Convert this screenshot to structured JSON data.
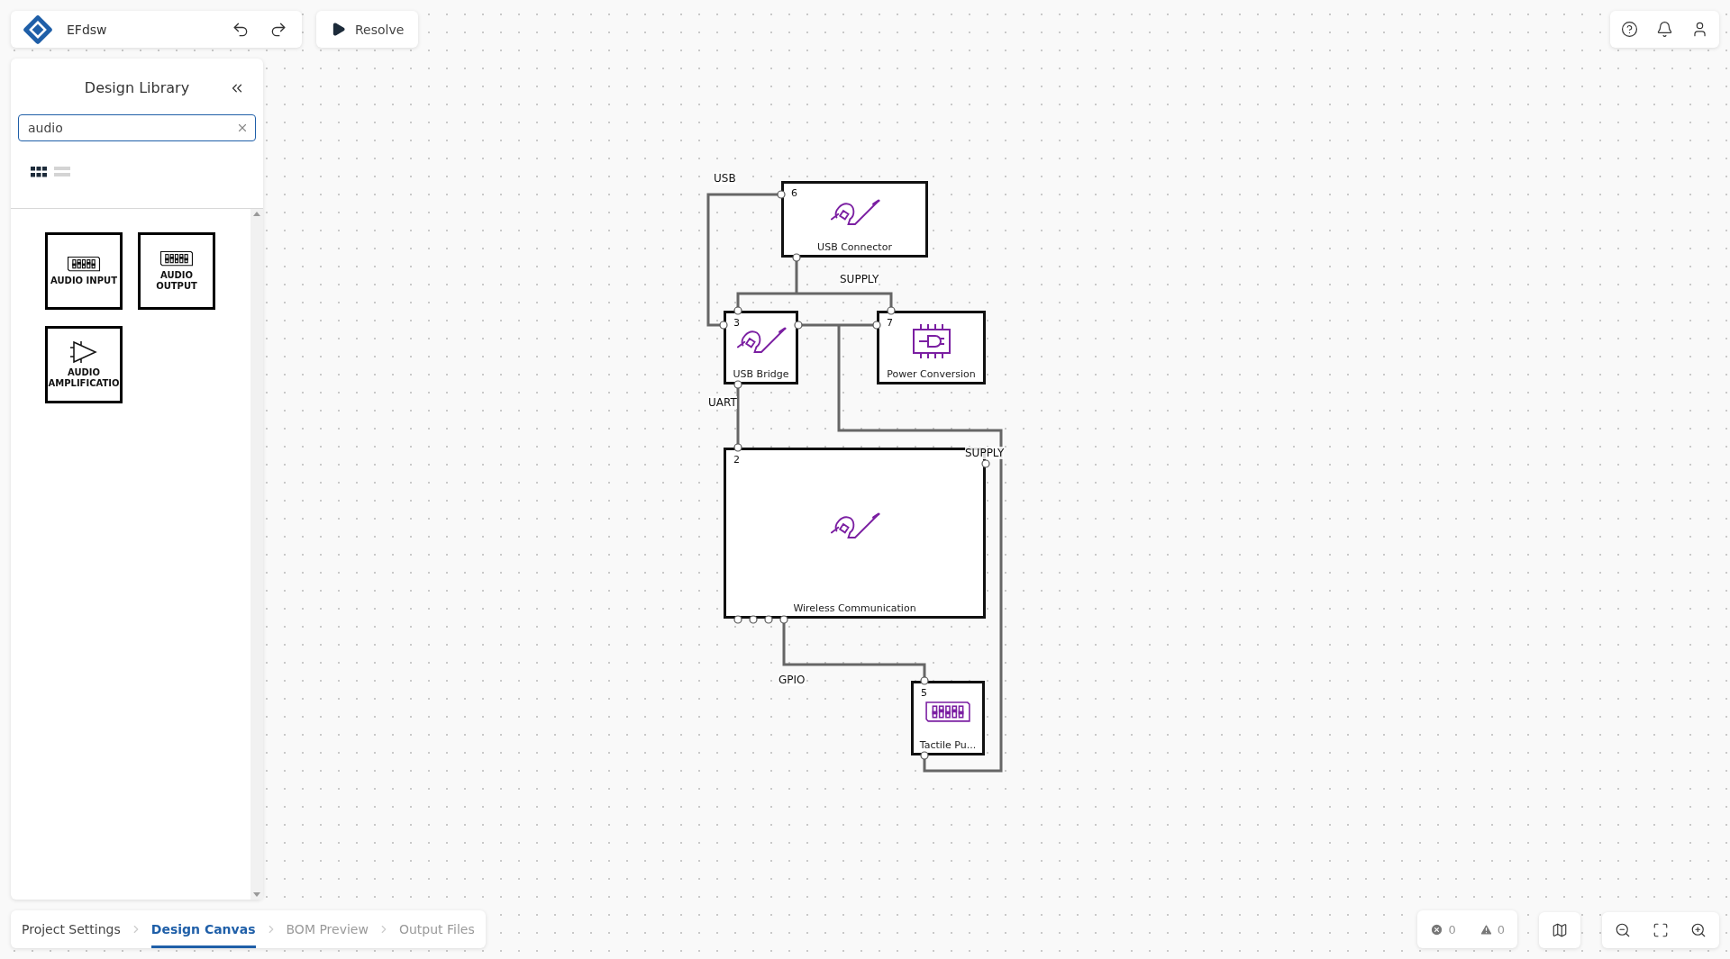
{
  "project": {
    "name": "EFdsw"
  },
  "resolve": {
    "label": "Resolve"
  },
  "library": {
    "title": "Design Library",
    "search": {
      "value": "audio"
    },
    "views": [
      {
        "kind": "grid",
        "selected": true
      },
      {
        "kind": "list",
        "selected": false
      }
    ],
    "items": [
      {
        "label": "AUDIO INPUT",
        "kind": "switch"
      },
      {
        "label": "AUDIO OUTPUT",
        "kind": "switch"
      },
      {
        "label": "AUDIO AMPLIFICATIO",
        "kind": "amplifier"
      }
    ]
  },
  "canvas": {
    "nodes": [
      {
        "number": "6",
        "label": "USB Connector",
        "kind": "cable"
      },
      {
        "number": "3",
        "label": "USB Bridge",
        "kind": "cable"
      },
      {
        "number": "7",
        "label": "Power Conversion",
        "kind": "chip"
      },
      {
        "number": "2",
        "label": "Wireless Communication",
        "kind": "cable"
      },
      {
        "number": "5",
        "label": "Tactile Pu...",
        "kind": "switch"
      }
    ],
    "net_labels": [
      "USB",
      "SUPPLY",
      "UART",
      "SUPPLY",
      "GPIO"
    ]
  },
  "steps": [
    {
      "label": "Project Settings",
      "selected": false,
      "done": true
    },
    {
      "label": "Design Canvas",
      "selected": true,
      "done": false
    },
    {
      "label": "BOM Preview",
      "selected": false,
      "done": false
    },
    {
      "label": "Output Files",
      "selected": false,
      "done": false
    }
  ],
  "status": {
    "errors": "0",
    "warnings": "0"
  }
}
